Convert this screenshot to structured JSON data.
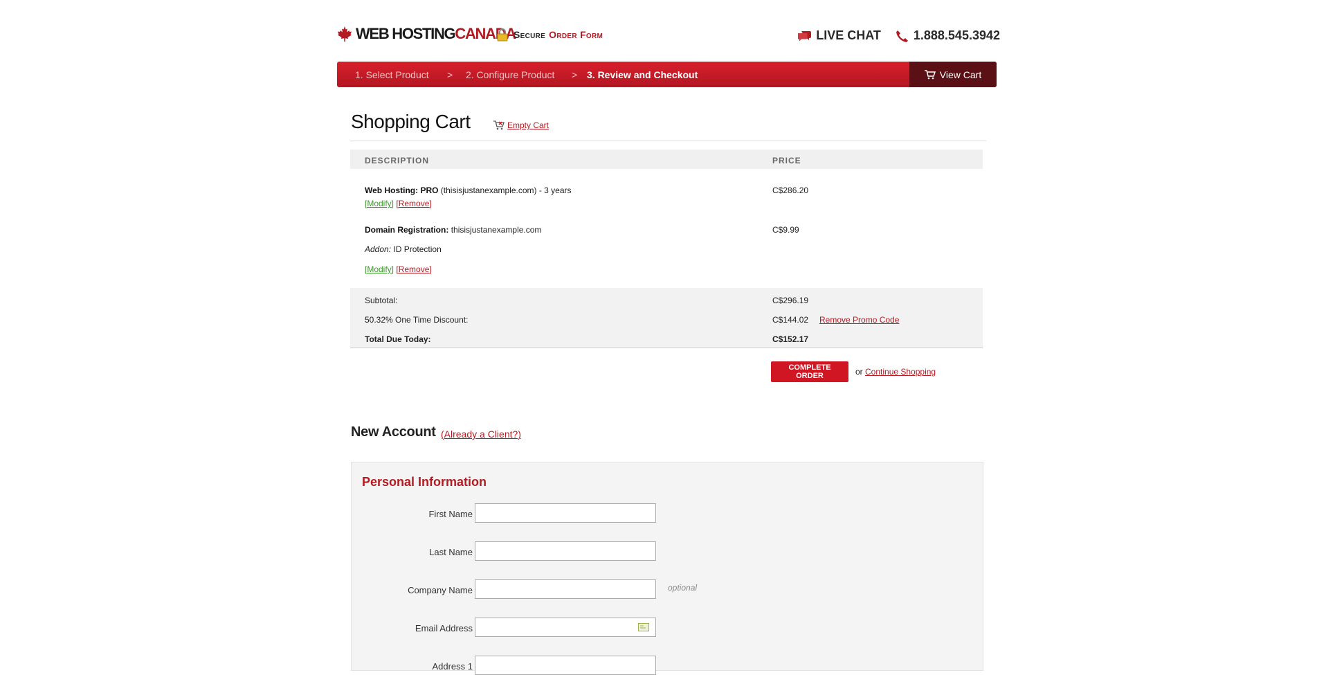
{
  "header": {
    "brand_web": "WEB HOSTING",
    "brand_canada": "CANADA",
    "secure_word": "Secure",
    "order_form": "Order Form",
    "live_chat": "LIVE CHAT",
    "phone": "1.888.545.3942"
  },
  "steps": [
    {
      "label": "1. Select Product"
    },
    {
      "label": "2. Configure Product"
    },
    {
      "label": "3. Review and Checkout"
    }
  ],
  "step_separator": ">",
  "view_cart": "View Cart",
  "cart": {
    "title": "Shopping Cart",
    "empty_link": "Empty Cart",
    "columns": {
      "description": "DESCRIPTION",
      "price": "PRICE"
    },
    "items": [
      {
        "name": "Web Hosting: PRO",
        "detail": "(thisisjustanexample.com) - 3 years",
        "price": "C$286.20",
        "modify": "[Modify]",
        "remove": "[Remove]"
      },
      {
        "name": "Domain Registration:",
        "detail": "thisisjustanexample.com",
        "addon_label": "Addon:",
        "addon_value": "ID Protection",
        "price": "C$9.99",
        "modify": "[Modify]",
        "remove": "[Remove]"
      }
    ],
    "subtotal_label": "Subtotal:",
    "subtotal_value": "C$296.19",
    "discount_label": "50.32% One Time Discount:",
    "discount_value": "C$144.02",
    "remove_promo": "Remove Promo Code",
    "total_label": "Total Due Today:",
    "total_value": "C$152.17",
    "complete_button": "COMPLETE ORDER",
    "or_text": "or",
    "continue_shopping": "Continue Shopping"
  },
  "account": {
    "title": "New Account",
    "already_client": "(Already a Client?)",
    "panel_title": "Personal Information",
    "fields": [
      {
        "label": "First Name",
        "value": ""
      },
      {
        "label": "Last Name",
        "value": ""
      },
      {
        "label": "Company Name",
        "value": "",
        "note": "optional"
      },
      {
        "label": "Email Address",
        "value": ""
      },
      {
        "label": "Address 1",
        "value": ""
      }
    ]
  },
  "colors": {
    "brand_red": "#b31b22",
    "bar_red": "#d7202b",
    "cart_dark": "#5a1014",
    "link_green": "#3a9a2a"
  }
}
